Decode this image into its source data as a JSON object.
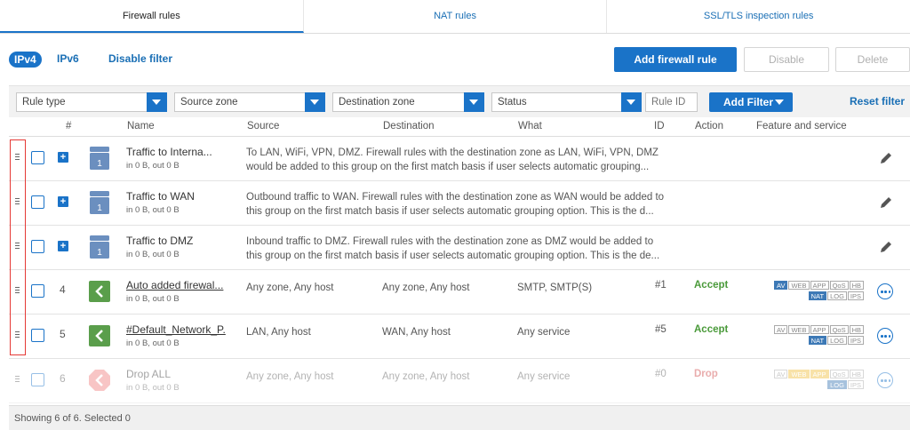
{
  "tabs": [
    {
      "label": "Firewall rules",
      "active": true
    },
    {
      "label": "NAT rules",
      "active": false
    },
    {
      "label": "SSL/TLS inspection rules",
      "active": false
    }
  ],
  "toolbar": {
    "ipv4": "IPv4",
    "ipv6": "IPv6",
    "disable_filter": "Disable filter",
    "add_rule": "Add firewall rule",
    "disable": "Disable",
    "delete": "Delete"
  },
  "filters": {
    "rule_type": "Rule type",
    "source_zone": "Source zone",
    "destination_zone": "Destination zone",
    "status": "Status",
    "rule_id_placeholder": "Rule ID",
    "add_filter": "Add Filter",
    "reset_filter": "Reset filter"
  },
  "columns": {
    "num": "#",
    "name": "Name",
    "source": "Source",
    "destination": "Destination",
    "what": "What",
    "id": "ID",
    "action": "Action",
    "feature": "Feature and service"
  },
  "rows": [
    {
      "name": "Traffic to Interna...",
      "sub": "in 0 B, out 0 B",
      "desc": "To LAN, WiFi, VPN, DMZ. Firewall rules with the destination zone as LAN, WiFi, VPN, DMZ would be added to this group on the first match basis if user selects automatic grouping..."
    },
    {
      "name": "Traffic to WAN",
      "sub": "in 0 B, out 0 B",
      "desc": "Outbound traffic to WAN. Firewall rules with the destination zone as WAN would be added to this group on the first match basis if user selects automatic grouping option. This is the d..."
    },
    {
      "name": "Traffic to DMZ",
      "sub": "in 0 B, out 0 B",
      "desc": "Inbound traffic to DMZ. Firewall rules with the destination zone as DMZ would be added to this group on the first match basis if user selects automatic grouping option. This is the de..."
    },
    {
      "num": "4",
      "name": "Auto added firewal...",
      "sub": "in 0 B, out 0 B",
      "source": "Any zone, Any host",
      "destination": "Any zone, Any host",
      "what": "SMTP, SMTP(S)",
      "id": "#1",
      "action": "Accept"
    },
    {
      "num": "5",
      "name": "#Default_Network_P.",
      "sub": "in 0 B, out 0 B",
      "source": "LAN, Any host",
      "destination": "WAN, Any host",
      "what": "Any service",
      "id": "#5",
      "action": "Accept"
    },
    {
      "num": "6",
      "name": "Drop ALL",
      "sub": "in 0 B, out 0 B",
      "source": "Any zone, Any host",
      "destination": "Any zone, Any host",
      "what": "Any service",
      "id": "#0",
      "action": "Drop"
    }
  ],
  "badges": {
    "row1": [
      "AV",
      "WEB",
      "APP",
      "QoS",
      "HB"
    ],
    "row2": [
      "NAT",
      "LOG",
      "IPS"
    ]
  },
  "group_badge_number": "1",
  "footer": "Showing 6 of 6. Selected 0",
  "colors": {
    "accent": "#1a73c8",
    "accept": "#4a9a3a",
    "drop": "#d04848",
    "rule_icon": "#5a9e4b",
    "group_icon": "#6b8fbf"
  }
}
